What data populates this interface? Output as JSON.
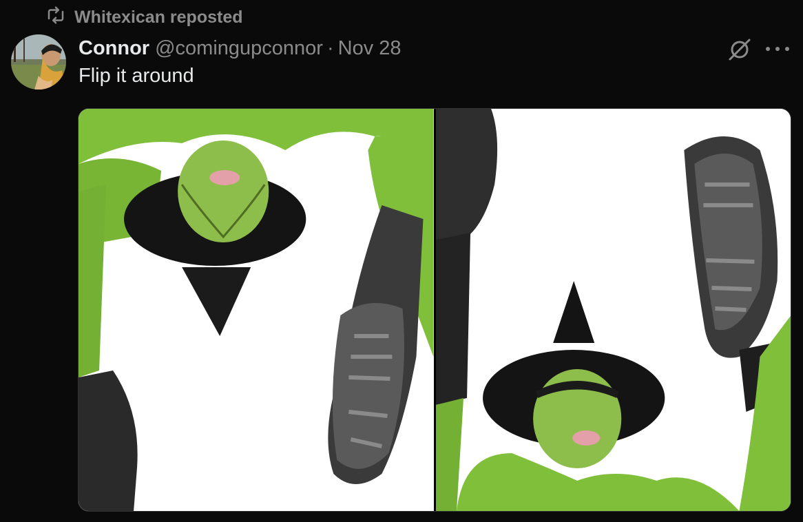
{
  "repost": {
    "text": "Whitexican reposted",
    "icon": "repost-icon"
  },
  "tweet": {
    "display_name": "Connor",
    "handle": "@comingupconnor",
    "separator": "·",
    "date": "Nov 28",
    "text": "Flip it around"
  },
  "icons": {
    "grok": "grok-icon",
    "more": "more-icon"
  },
  "media": [
    {
      "alt": "upside-down photo",
      "orientation": "flipped"
    },
    {
      "alt": "right-side-up photo",
      "orientation": "upright"
    }
  ],
  "colors": {
    "background": "#0a0a0a",
    "primary_text": "#e7e9ea",
    "secondary_text": "#8b8b8b",
    "skin_green": "#7fbf3a",
    "hat_black": "#141414"
  }
}
